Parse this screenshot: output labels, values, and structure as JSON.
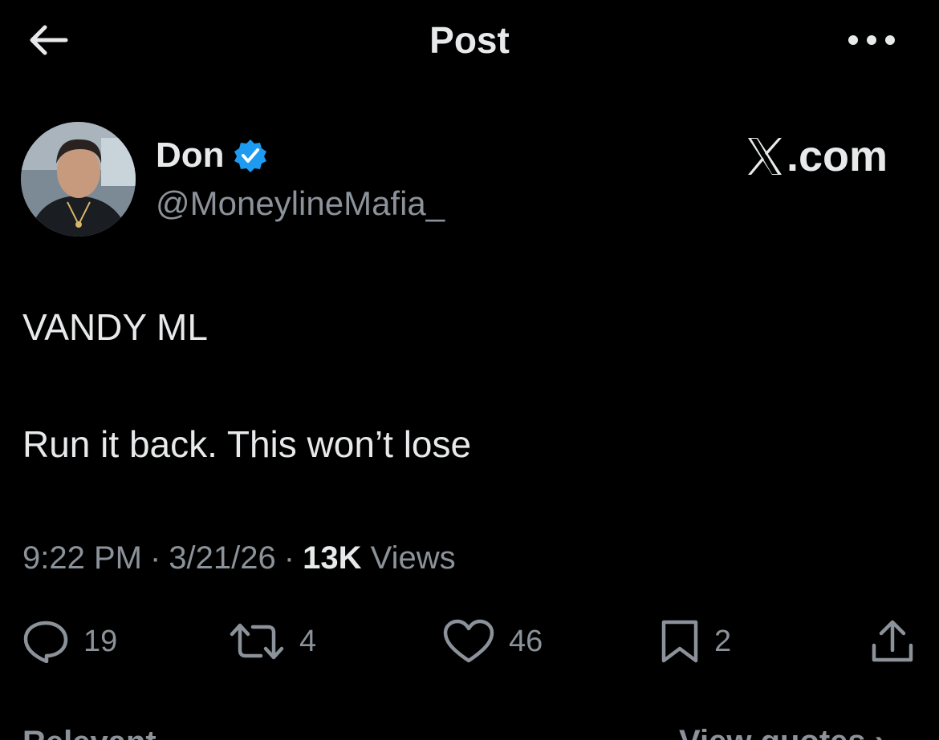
{
  "header": {
    "title": "Post"
  },
  "author": {
    "name": "Don",
    "handle": "@MoneylineMafia_",
    "verified": true
  },
  "brand": {
    "watermark": "X.com"
  },
  "post": {
    "lines": [
      "VANDY ML",
      "Run it back. This won’t lose"
    ]
  },
  "meta": {
    "time": "9:22 PM",
    "separator": "·",
    "date": "3/21/26",
    "views_count": "13K",
    "views_label": "Views"
  },
  "actions": {
    "replies": "19",
    "reposts": "4",
    "likes": "46",
    "bookmarks": "2"
  },
  "footer": {
    "relevant": "Relevant ⌄",
    "view_quotes": "View quotes ›"
  },
  "colors": {
    "background": "#000000",
    "text": "#e7e9ea",
    "muted": "#8b9299",
    "verified": "#1d9bf0"
  },
  "icons": [
    "back-arrow-icon",
    "more-dots-icon",
    "verified-badge-icon",
    "x-logo-icon",
    "reply-icon",
    "repost-icon",
    "like-icon",
    "bookmark-icon",
    "share-icon"
  ]
}
